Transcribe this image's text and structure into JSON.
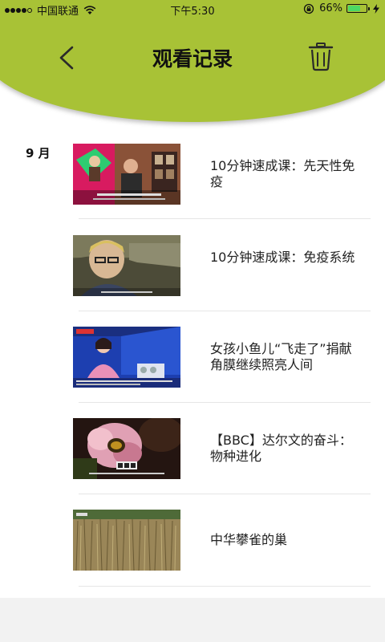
{
  "status_bar": {
    "carrier": "中国联通",
    "time": "下午5:30",
    "battery_percent": "66%",
    "battery_level": 0.66
  },
  "header": {
    "title": "观看记录",
    "back_icon": "chevron-left-icon",
    "delete_icon": "trash-icon"
  },
  "section": {
    "month": "9 月"
  },
  "history": [
    {
      "title": "10分钟速成课：先天性免疫"
    },
    {
      "title": "10分钟速成课：免疫系统"
    },
    {
      "title": "女孩小鱼儿“飞走了”捐献角膜继续照亮人间"
    },
    {
      "title": "【BBC】达尔文的奋斗：物种进化"
    },
    {
      "title": "中华攀雀的巢"
    }
  ],
  "colors": {
    "header": "#a8c236"
  }
}
